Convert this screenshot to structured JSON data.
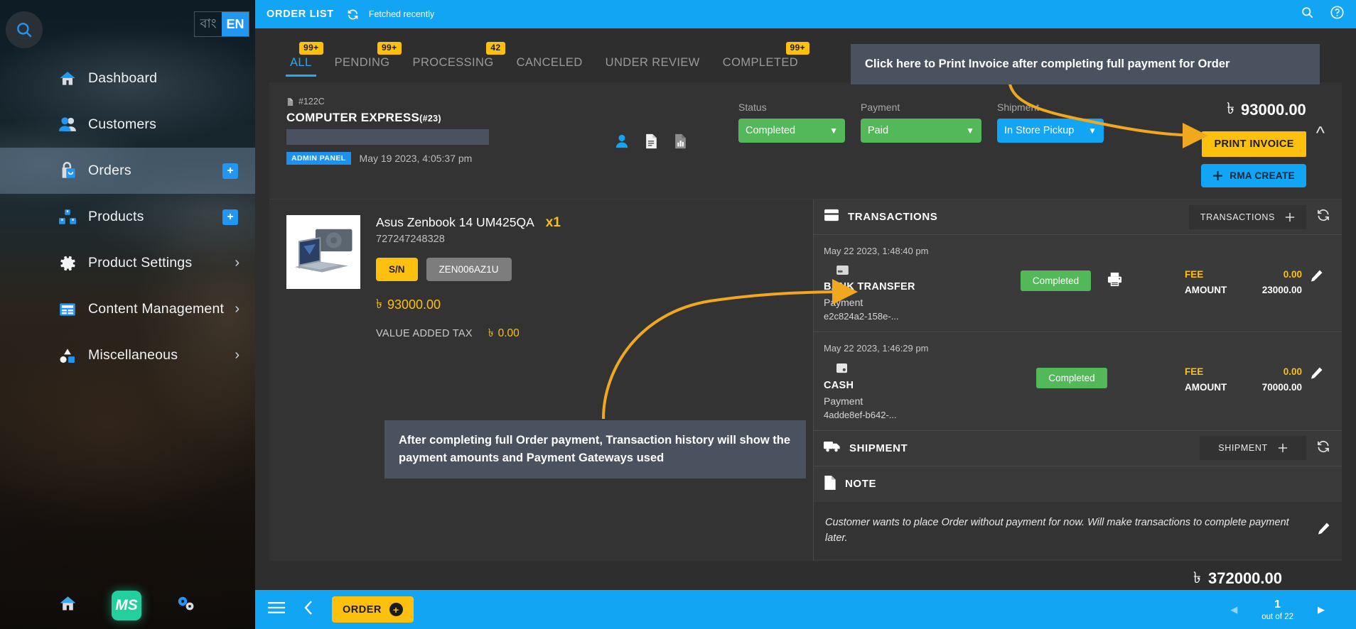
{
  "sidebar": {
    "search_icon": "search-icon",
    "language": {
      "options": [
        "বাং",
        "EN"
      ],
      "selected": "EN"
    },
    "items": [
      {
        "label": "Dashboard",
        "icon": "home-icon",
        "active": false,
        "accessory": "none"
      },
      {
        "label": "Customers",
        "icon": "users-icon",
        "active": false,
        "accessory": "none"
      },
      {
        "label": "Orders",
        "icon": "bag-icon",
        "active": true,
        "accessory": "plus"
      },
      {
        "label": "Products",
        "icon": "boxes-icon",
        "active": false,
        "accessory": "plus"
      },
      {
        "label": "Product Settings",
        "icon": "gear-icon",
        "active": false,
        "accessory": "chevron"
      },
      {
        "label": "Content Management",
        "icon": "layout-icon",
        "active": false,
        "accessory": "chevron"
      },
      {
        "label": "Miscellaneous",
        "icon": "shapes-icon",
        "active": false,
        "accessory": "chevron"
      }
    ],
    "footer": {
      "home_icon": "home-icon",
      "brand": "MS",
      "settings_icon": "gears-icon"
    }
  },
  "topbar": {
    "title": "ORDER LIST",
    "refresh_icon": "refresh-icon",
    "fetch_status": "Fetched recently",
    "search_icon": "search-icon",
    "help_icon": "help-circle-icon"
  },
  "tabs": [
    {
      "label": "ALL",
      "badge": "99+",
      "active": true
    },
    {
      "label": "PENDING",
      "badge": "99+",
      "active": false
    },
    {
      "label": "PROCESSING",
      "badge": "42",
      "active": false
    },
    {
      "label": "CANCELED",
      "badge": "",
      "active": false
    },
    {
      "label": "UNDER REVIEW",
      "badge": "",
      "active": false
    },
    {
      "label": "COMPLETED",
      "badge": "99+",
      "active": false
    }
  ],
  "order": {
    "code": "#122C",
    "customer": "COMPUTER EXPRESS",
    "customer_id": "(#23)",
    "source_pill": "ADMIN PANEL",
    "date": "May 19 2023, 4:05:37 pm",
    "icons": [
      "person-icon",
      "document-icon",
      "chart-icon"
    ],
    "selects": [
      {
        "label": "Status",
        "value": "Completed",
        "color": "#52b85a"
      },
      {
        "label": "Payment",
        "value": "Paid",
        "color": "#52b85a"
      },
      {
        "label": "Shipment",
        "value": "In Store Pickup",
        "color": "#12a5f4"
      }
    ],
    "currency": "৳",
    "total": "93000.00",
    "print_invoice_label": "PRINT INVOICE",
    "rma_create_label": "RMA CREATE",
    "collapse_icon": "chevron-up-icon"
  },
  "product": {
    "title": "Asus Zenbook 14 UM425QA",
    "sku": "727247248328",
    "qty": "x1",
    "sn_tag": "S/N",
    "sn_value": "ZEN006AZ1U",
    "price": "93000.00",
    "vat_label": "VALUE ADDED TAX",
    "vat_value": "0.00",
    "currency": "৳"
  },
  "transactions_panel": {
    "title": "TRANSACTIONS",
    "icon": "card-icon",
    "add_label": "TRANSACTIONS",
    "add_icon": "plus-icon",
    "refresh_icon": "refresh-icon",
    "rows": [
      {
        "date": "May 22 2023, 1:48:40 pm",
        "gateway": "BANK TRANSFER",
        "gateway_icon": "bank-card-icon",
        "type": "Payment",
        "id": "e2c824a2-158e-...",
        "status": "Completed",
        "print_icon": "printer-icon",
        "fee_label": "FEE",
        "fee_value": "0.00",
        "amount_label": "AMOUNT",
        "amount_value": "23000.00",
        "edit_icon": "pencil-icon"
      },
      {
        "date": "May 22 2023, 1:46:29 pm",
        "gateway": "CASH",
        "gateway_icon": "cash-icon",
        "type": "Payment",
        "id": "4adde8ef-b642-...",
        "status": "Completed",
        "print_icon": "",
        "fee_label": "FEE",
        "fee_value": "0.00",
        "amount_label": "AMOUNT",
        "amount_value": "70000.00",
        "edit_icon": "pencil-icon"
      }
    ]
  },
  "shipment_panel": {
    "title": "SHIPMENT",
    "icon": "truck-icon",
    "add_label": "SHIPMENT",
    "add_icon": "plus-icon",
    "refresh_icon": "refresh-icon"
  },
  "note_panel": {
    "title": "NOTE",
    "icon": "note-icon",
    "text": "Customer wants to place Order without payment for now. Will make transactions to complete payment later.",
    "edit_icon": "pencil-icon"
  },
  "grand_total": {
    "currency": "৳",
    "value": "372000.00"
  },
  "bottombar": {
    "menu_icon": "hamburger-icon",
    "back_icon": "chevron-left-icon",
    "order_label": "ORDER",
    "order_plus_icon": "plus-icon",
    "pager": {
      "prev_icon": "triangle-left-icon",
      "page": "1",
      "out_of": "out of 22",
      "next_icon": "triangle-right-icon"
    }
  },
  "annotations": [
    {
      "id": "print",
      "text": "Click here to Print Invoice after completing full payment for Order"
    },
    {
      "id": "txn",
      "text": "After completing full Order payment, Transaction history will show the payment amounts and Payment Gateways used"
    }
  ],
  "colors": {
    "accent_blue": "#12a5f4",
    "accent_yellow": "#fdc00f",
    "success_green": "#52b85a",
    "anno_bg": "#4a5260",
    "arrow": "#f0a81e"
  }
}
